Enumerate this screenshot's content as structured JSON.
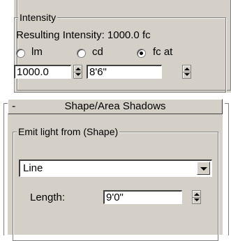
{
  "intensity": {
    "group_title": "Intensity",
    "resulting_label": "Resulting Intensity: 1000.0 fc",
    "units": [
      {
        "label": "lm",
        "selected": false
      },
      {
        "label": "cd",
        "selected": false
      },
      {
        "label": "fc at",
        "selected": true
      }
    ],
    "value": "1000.0",
    "distance": "8'6\""
  },
  "shape_rollout": {
    "collapse_symbol": "-",
    "title": "Shape/Area Shadows",
    "emit_group_title": "Emit light from (Shape)",
    "shape_value": "Line",
    "length_label": "Length:",
    "length_value": "9'0\""
  }
}
